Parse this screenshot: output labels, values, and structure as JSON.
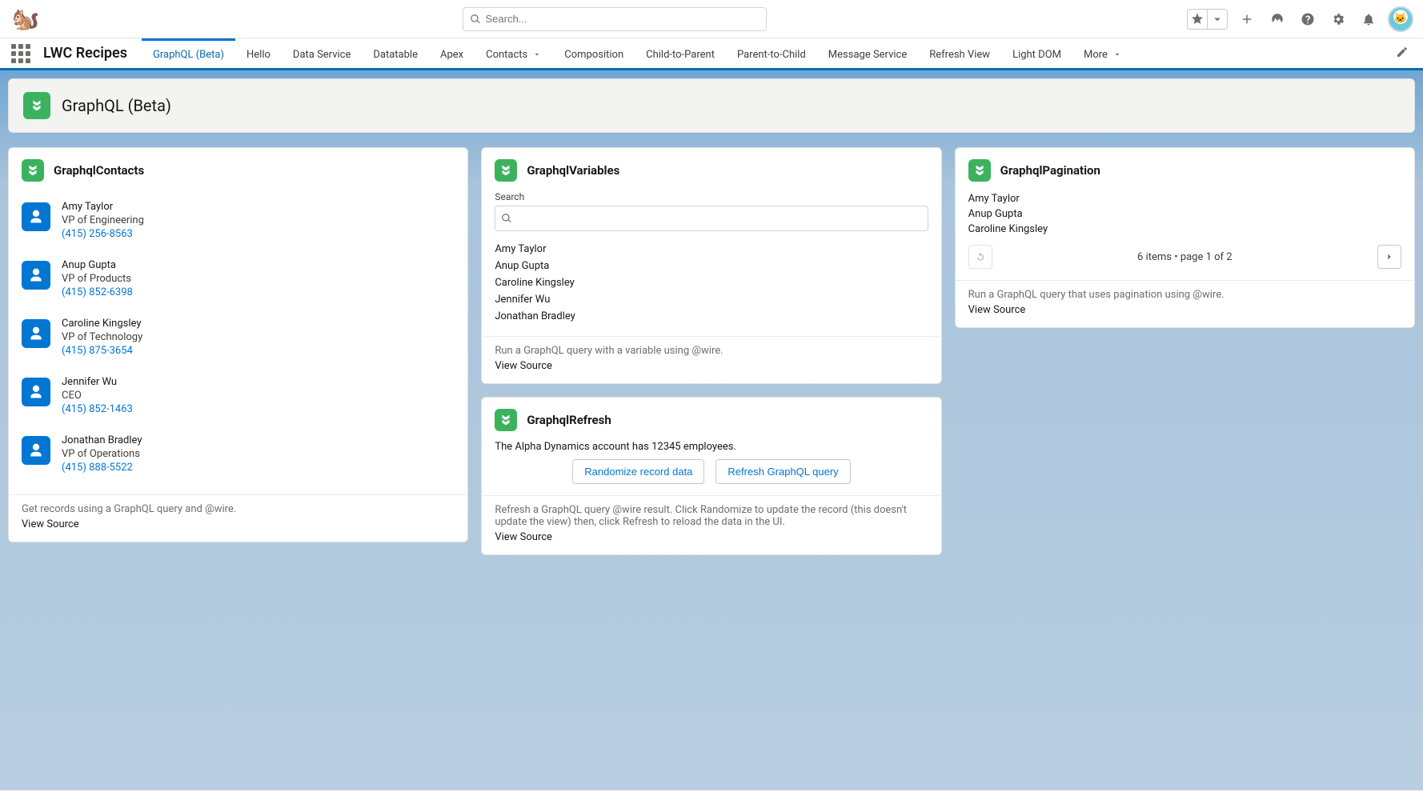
{
  "header": {
    "search_placeholder": "Search..."
  },
  "app": {
    "name": "LWC Recipes",
    "tabs": [
      "GraphQL (Beta)",
      "Hello",
      "Data Service",
      "Datatable",
      "Apex",
      "Contacts",
      "Composition",
      "Child-to-Parent",
      "Parent-to-Child",
      "Message Service",
      "Refresh View",
      "Light DOM",
      "More"
    ],
    "active_tab": "GraphQL (Beta)"
  },
  "page": {
    "title": "GraphQL (Beta)"
  },
  "cards": {
    "contacts": {
      "title": "GraphqlContacts",
      "items": [
        {
          "name": "Amy Taylor",
          "title": "VP of Engineering",
          "phone": "(415) 256-8563"
        },
        {
          "name": "Anup Gupta",
          "title": "VP of Products",
          "phone": "(415) 852-6398"
        },
        {
          "name": "Caroline Kingsley",
          "title": "VP of Technology",
          "phone": "(415) 875-3654"
        },
        {
          "name": "Jennifer Wu",
          "title": "CEO",
          "phone": "(415) 852-1463"
        },
        {
          "name": "Jonathan Bradley",
          "title": "VP of Operations",
          "phone": "(415) 888-5522"
        }
      ],
      "desc": "Get records using a GraphQL query and @wire.",
      "view_source": "View Source"
    },
    "variables": {
      "title": "GraphqlVariables",
      "search_label": "Search",
      "names": [
        "Amy Taylor",
        "Anup Gupta",
        "Caroline Kingsley",
        "Jennifer Wu",
        "Jonathan Bradley"
      ],
      "desc": "Run a GraphQL query with a variable using @wire.",
      "view_source": "View Source"
    },
    "refresh": {
      "title": "GraphqlRefresh",
      "message": "The Alpha Dynamics account has 12345 employees.",
      "btn_randomize": "Randomize record data",
      "btn_refresh": "Refresh GraphQL query",
      "desc": "Refresh a GraphQL query @wire result. Click Randomize to update the record (this doesn't update the view) then, click Refresh to reload the data in the UI.",
      "view_source": "View Source"
    },
    "pagination": {
      "title": "GraphqlPagination",
      "names": [
        "Amy Taylor",
        "Anup Gupta",
        "Caroline Kingsley"
      ],
      "pager_text": "6 items • page 1 of 2",
      "desc": "Run a GraphQL query that uses pagination using @wire.",
      "view_source": "View Source"
    }
  }
}
